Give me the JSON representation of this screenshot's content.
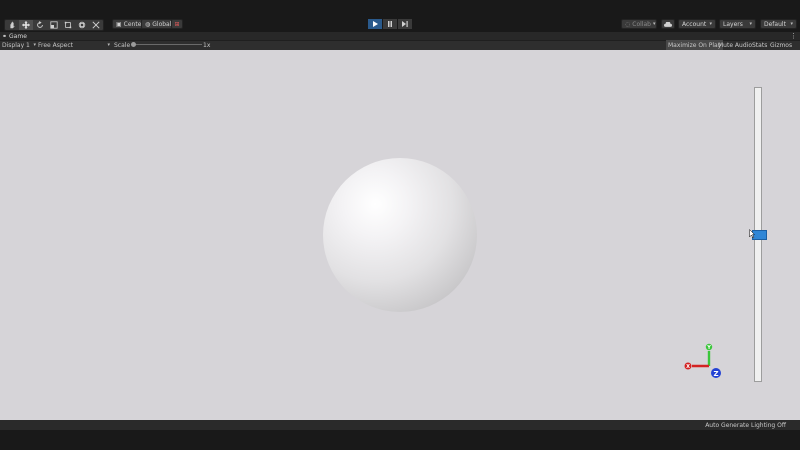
{
  "toolbar": {
    "pivot_label": "Center",
    "space_label": "Global",
    "collab_label": "Collab",
    "account_label": "Account",
    "layers_label": "Layers",
    "layout_label": "Default"
  },
  "tab": {
    "title": "Game"
  },
  "game_toolbar": {
    "display": "Display 1",
    "aspect": "Free Aspect",
    "scale_label": "Scale",
    "scale_value": "1x",
    "scale_fraction": 0.0,
    "buttons": [
      "Maximize On Play",
      "Mute Audio",
      "Stats",
      "Gizmos"
    ]
  },
  "viewport": {
    "zoom_slider_fraction": 0.5,
    "axes": {
      "x": "X",
      "y": "Y",
      "z": "Z"
    },
    "colors": {
      "background": "#d6d4d8",
      "x_axis": "#d42323",
      "y_axis": "#3ac63a",
      "z_axis": "#2342d4",
      "slider_handle": "#2f86d6"
    }
  },
  "status": {
    "text": "Auto Generate Lighting Off"
  },
  "icons": [
    "hand-tool-icon",
    "move-tool-icon",
    "rotate-tool-icon",
    "scale-tool-icon",
    "rect-tool-icon",
    "transform-tool-icon",
    "custom-tool-icon",
    "play-icon",
    "pause-icon",
    "step-icon",
    "cloud-icon",
    "more-icon"
  ]
}
